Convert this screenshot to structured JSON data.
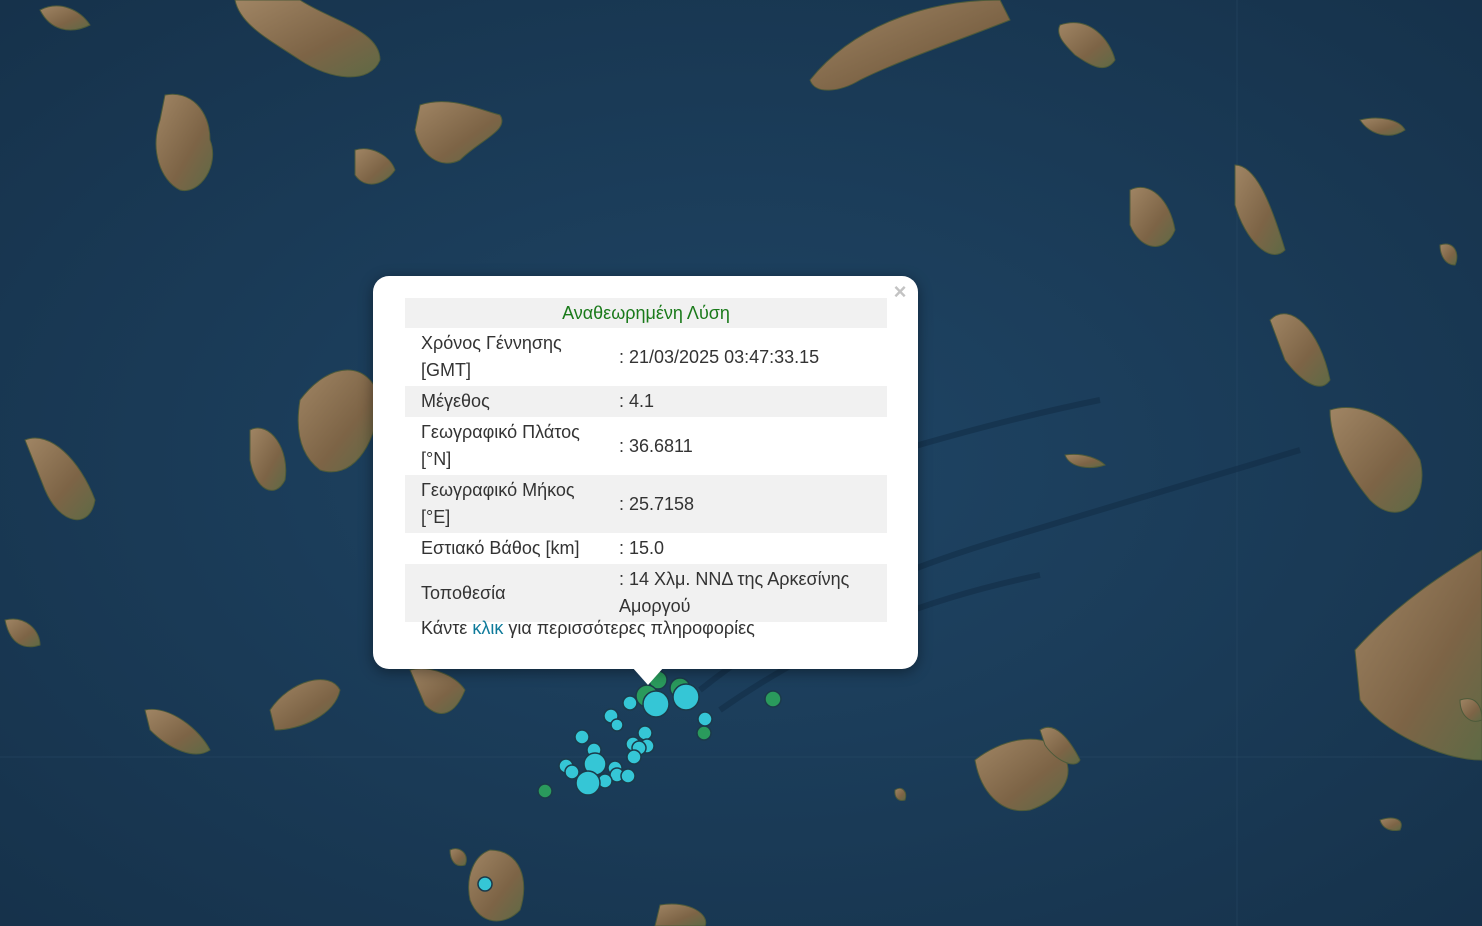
{
  "popup": {
    "title": "Αναθεωρημένη Λύση",
    "close_icon": "×",
    "rows": [
      {
        "label": "Χρόνος Γέννησης [GMT]",
        "value": ": 21/03/2025 03:47:33.15"
      },
      {
        "label": "Μέγεθος",
        "value": ": 4.1"
      },
      {
        "label": "Γεωγραφικό Πλάτος [°N]",
        "value": ": 36.6811"
      },
      {
        "label": "Γεωγραφικό Μήκος [°E]",
        "value": ": 25.7158"
      },
      {
        "label": "Εστιακό Βάθος [km]",
        "value": ": 15.0"
      },
      {
        "label": "Τοποθεσία",
        "value": ": 14 Χλμ. ΝΝΔ της Αρκεσίνης Αμοργού"
      }
    ],
    "more_prefix": "Κάντε",
    "more_link": "κλικ",
    "more_suffix": "για περισσότερες πληροφορίες"
  },
  "colors": {
    "sea": "#1a3a55",
    "land": "#8a7052",
    "marker_cyan": "#35c6d6",
    "marker_green": "#2a9a5c",
    "title_green": "#1a7a1a",
    "link_blue": "#0e7a9a"
  }
}
